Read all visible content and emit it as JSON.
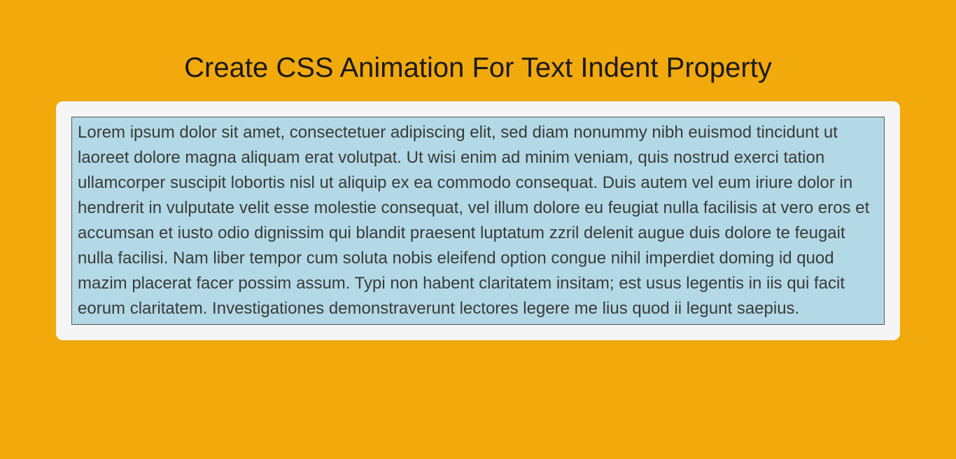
{
  "heading": "Create CSS Animation For Text Indent Property",
  "paragraph": "Lorem ipsum dolor sit amet, consectetuer adipiscing elit, sed diam nonummy nibh euismod tincidunt ut laoreet dolore magna aliquam erat volutpat. Ut wisi enim ad minim veniam, quis nostrud exerci tation ullamcorper suscipit lobortis nisl ut aliquip ex ea commodo consequat. Duis autem vel eum iriure dolor in hendrerit in vulputate velit esse molestie consequat, vel illum dolore eu feugiat nulla facilisis at vero eros et accumsan et iusto odio dignissim qui blandit praesent luptatum zzril delenit augue duis dolore te feugait nulla facilisi. Nam liber tempor cum soluta nobis eleifend option congue nihil imperdiet doming id quod mazim placerat facer possim assum. Typi non habent claritatem insitam; est usus legentis in iis qui facit eorum claritatem. Investigationes demonstraverunt lectores legere me lius quod ii legunt saepius."
}
